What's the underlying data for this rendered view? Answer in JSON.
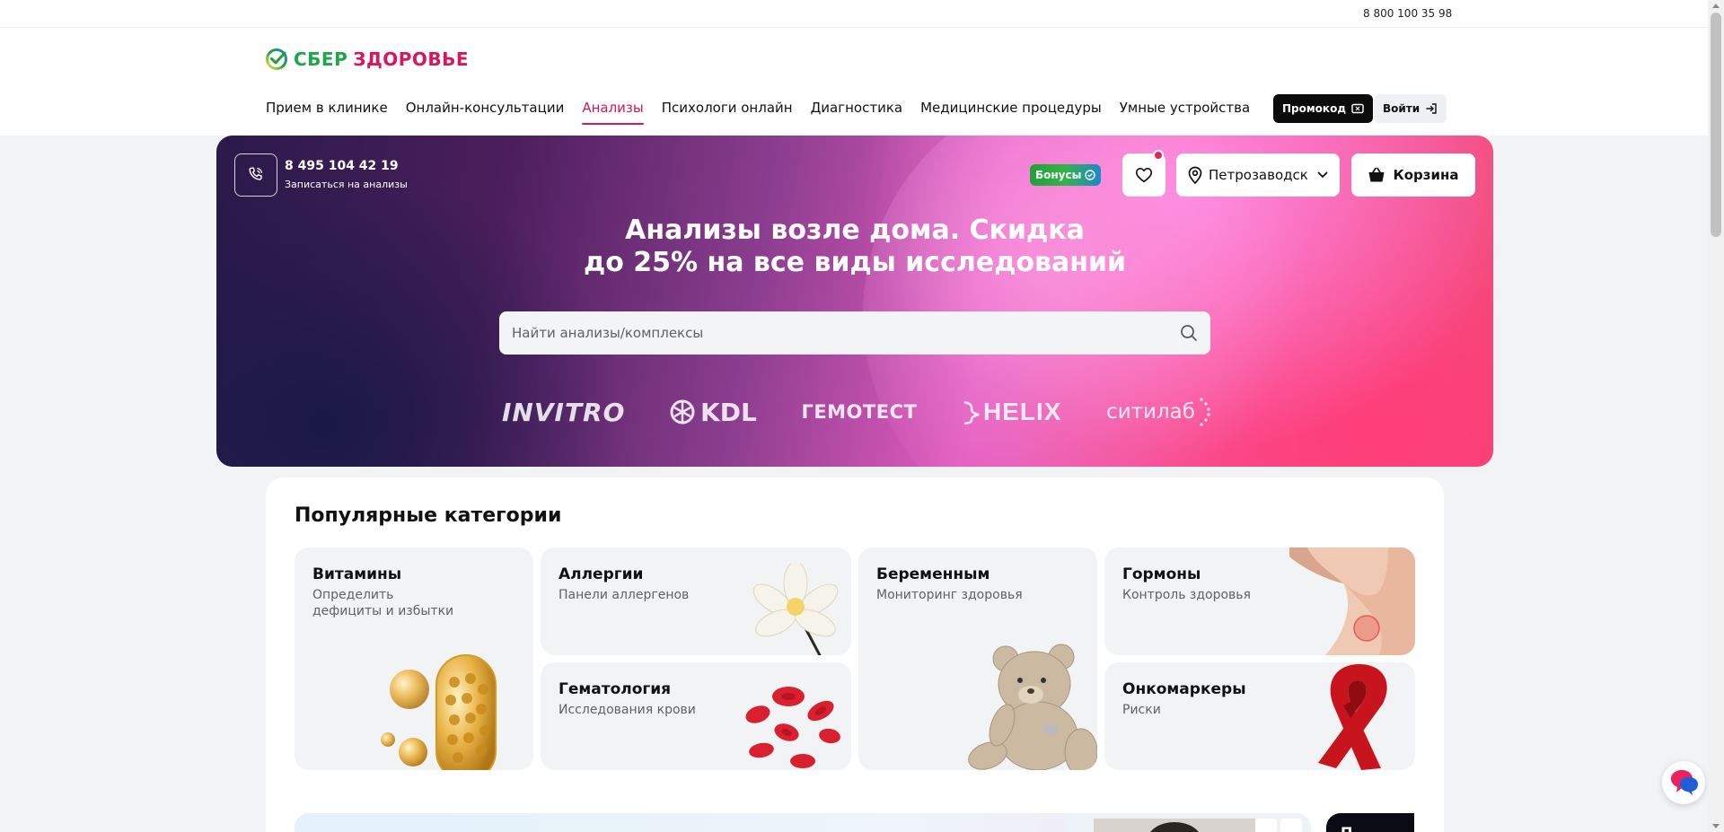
{
  "topbar": {
    "phone": "8 800 100 35 98"
  },
  "logo": {
    "word1": "СБЕР",
    "word2": "ЗДОРОВЬЕ"
  },
  "nav": [
    "Прием в клинике",
    "Онлайн-консультации",
    "Анализы",
    "Психологи онлайн",
    "Диагностика",
    "Медицинские процедуры",
    "Умные устройства"
  ],
  "nav_active": "Анализы",
  "header_buttons": {
    "promo": "Промокод",
    "login": "Войти"
  },
  "hero": {
    "phone": "8 495 104 42 19",
    "phone_caption": "Записаться на анализы",
    "bonus": "Бонусы",
    "city": "Петрозаводск",
    "cart": "Корзина",
    "title_line1": "Анализы возле дома. Скидка",
    "title_line2": "до 25% на все виды исследований",
    "search_placeholder": "Найти анализы/комплексы",
    "labs": [
      "INVITRO",
      "KDL",
      "ГЕМОТЕСТ",
      "HELIX",
      "ситилаб"
    ]
  },
  "categories": {
    "title": "Популярные категории",
    "items": [
      {
        "title": "Витамины",
        "subtitle": "Определить дефициты и избытки"
      },
      {
        "title": "Аллергии",
        "subtitle": "Панели аллергенов"
      },
      {
        "title": "Гематология",
        "subtitle": "Исследования крови"
      },
      {
        "title": "Беременным",
        "subtitle": "Мониторинг здоровья"
      },
      {
        "title": "Гормоны",
        "subtitle": "Контроль здоровья"
      },
      {
        "title": "Онкомаркеры",
        "subtitle": "Риски"
      }
    ]
  },
  "banner_dark_text": "П",
  "colors": {
    "brand_green": "#1fa64a",
    "brand_pink": "#d5175e",
    "accent_red": "#e8245f"
  },
  "icons": [
    "phone-icon",
    "heart-icon",
    "location-pin-icon",
    "chevron-down-icon",
    "basket-icon",
    "search-icon",
    "promo-ticket-icon",
    "login-arrow-icon",
    "chat-icon"
  ]
}
